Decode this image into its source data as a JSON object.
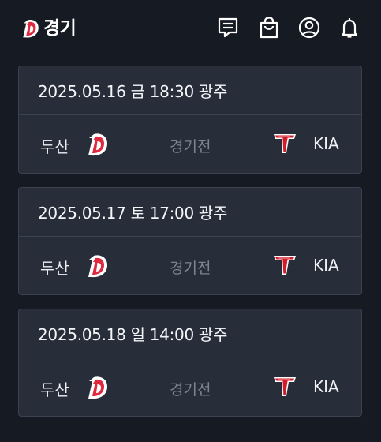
{
  "header": {
    "title": "경기",
    "icons": [
      "chat-icon",
      "shopping-bag-icon",
      "profile-icon",
      "notification-bell-icon"
    ]
  },
  "colors": {
    "background": "#161a23",
    "card": "#272d39",
    "doosan_red": "#e0283e",
    "kia_red": "#d31c2a"
  },
  "games": [
    {
      "date": "2025.05.16 금 18:30 광주",
      "home": "두산",
      "away": "KIA",
      "status": "경기전"
    },
    {
      "date": "2025.05.17 토 17:00 광주",
      "home": "두산",
      "away": "KIA",
      "status": "경기전"
    },
    {
      "date": "2025.05.18 일 14:00 광주",
      "home": "두산",
      "away": "KIA",
      "status": "경기전"
    }
  ]
}
